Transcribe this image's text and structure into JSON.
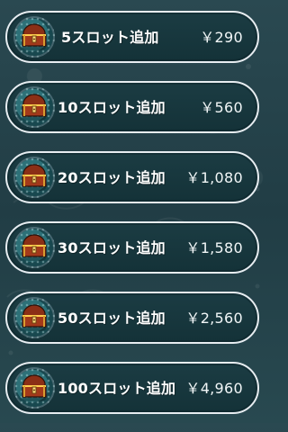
{
  "background": {
    "colors": {
      "base": "#27454d",
      "panel": "#173841",
      "border": "#e7edf1",
      "text": "#ffffff"
    }
  },
  "items": [
    {
      "label": "5スロット追加",
      "price": "￥290",
      "icon": "treasure-chest-icon"
    },
    {
      "label": "10スロット追加",
      "price": "￥560",
      "icon": "treasure-chest-icon"
    },
    {
      "label": "20スロット追加",
      "price": "￥1,080",
      "icon": "treasure-chest-icon"
    },
    {
      "label": "30スロット追加",
      "price": "￥1,580",
      "icon": "treasure-chest-icon"
    },
    {
      "label": "50スロット追加",
      "price": "￥2,560",
      "icon": "treasure-chest-icon"
    },
    {
      "label": "100スロット追加",
      "price": "￥4,960",
      "icon": "treasure-chest-icon"
    }
  ]
}
